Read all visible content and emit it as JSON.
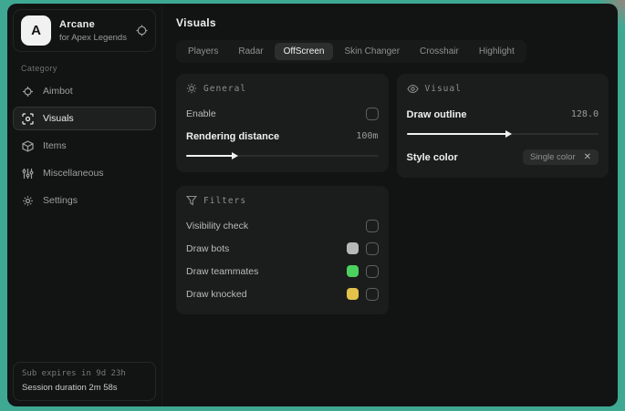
{
  "app": {
    "name": "Arcane",
    "subtitle": "for Apex Legends",
    "logo_letter": "A"
  },
  "sidebar": {
    "category_label": "Category",
    "items": [
      {
        "label": "Aimbot",
        "icon": "crosshair-icon",
        "selected": false
      },
      {
        "label": "Visuals",
        "icon": "focus-icon",
        "selected": true
      },
      {
        "label": "Items",
        "icon": "cube-icon",
        "selected": false
      },
      {
        "label": "Miscellaneous",
        "icon": "sliders-icon",
        "selected": false
      },
      {
        "label": "Settings",
        "icon": "gear-icon",
        "selected": false
      }
    ],
    "footer": {
      "sub_expires": "Sub expires in 9d 23h",
      "session_duration": "Session duration 2m 58s"
    }
  },
  "main": {
    "title": "Visuals",
    "tabs": [
      {
        "label": "Players",
        "selected": false
      },
      {
        "label": "Radar",
        "selected": false
      },
      {
        "label": "OffScreen",
        "selected": true
      },
      {
        "label": "Skin Changer",
        "selected": false
      },
      {
        "label": "Crosshair",
        "selected": false
      },
      {
        "label": "Highlight",
        "selected": false
      }
    ],
    "panels": {
      "general": {
        "title": "General",
        "enable_label": "Enable",
        "enable_checked": false,
        "rendering_distance_label": "Rendering distance",
        "rendering_distance_value": "100m",
        "rendering_distance_percent": 24
      },
      "visual": {
        "title": "Visual",
        "draw_outline_label": "Draw outline",
        "draw_outline_value": "128.0",
        "draw_outline_percent": 52,
        "style_color_label": "Style color",
        "style_color_value": "Single color",
        "style_color_clear": "✕"
      },
      "filters": {
        "title": "Filters",
        "rows": [
          {
            "label": "Visibility check",
            "swatch": null,
            "checked": false
          },
          {
            "label": "Draw bots",
            "swatch": "#b8b8b8",
            "checked": false
          },
          {
            "label": "Draw teammates",
            "swatch": "#4cd15f",
            "checked": false
          },
          {
            "label": "Draw knocked",
            "swatch": "#e3c24a",
            "checked": false
          }
        ]
      }
    }
  },
  "colors": {
    "frame": "#3fa893",
    "window_bg": "#121313",
    "panel_bg": "#1b1d1d",
    "accent": "#f2f2f2"
  }
}
